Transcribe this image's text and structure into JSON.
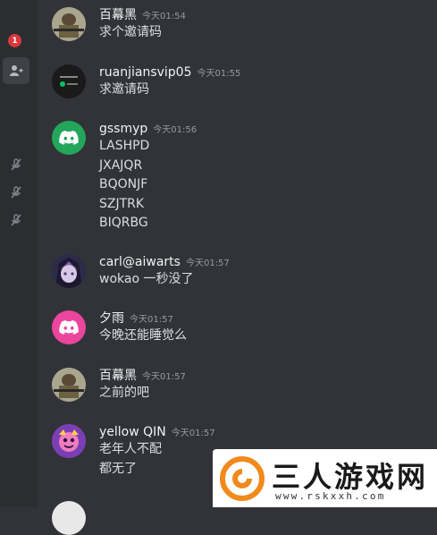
{
  "rail": {
    "badge_count": "1",
    "add_friend_icon": "add-friend-icon",
    "muted_icon": "muted-mic-icon"
  },
  "messages": [
    {
      "username": "百幕黑",
      "timestamp": "今天01:54",
      "lines": [
        "求个邀请码"
      ],
      "avatar": "photo-avatar"
    },
    {
      "username": "ruanjiansvip05",
      "timestamp": "今天01:55",
      "lines": [
        "求邀请码"
      ],
      "avatar": "wechat-avatar"
    },
    {
      "username": "gssmyp",
      "timestamp": "今天01:56",
      "lines": [
        "LASHPD",
        "JXAJQR",
        "BQONJF",
        "SZJTRK",
        "BIQRBG"
      ],
      "avatar": "discord-green-avatar"
    },
    {
      "username": "carl@aiwarts",
      "timestamp": "今天01:57",
      "lines": [
        "wokao 一秒没了"
      ],
      "avatar": "anime-avatar"
    },
    {
      "username": "夕雨",
      "timestamp": "今天01:57",
      "lines": [
        "今晚还能睡觉么"
      ],
      "avatar": "discord-pink-avatar"
    },
    {
      "username": "百幕黑",
      "timestamp": "今天01:57",
      "lines": [
        "之前的吧"
      ],
      "avatar": "photo-avatar"
    },
    {
      "username": "yellow QIN",
      "timestamp": "今天01:57",
      "lines": [
        "老年人不配",
        "都无了"
      ],
      "avatar": "cartoon-avatar"
    }
  ],
  "colors": {
    "background": "#313338",
    "rail": "#2b2d31",
    "discord_green": "#23a55a",
    "discord_pink": "#eb459e",
    "badge_red": "#da373c"
  },
  "watermark": {
    "title": "三人游戏网",
    "url": "www.rskxxh.com"
  }
}
